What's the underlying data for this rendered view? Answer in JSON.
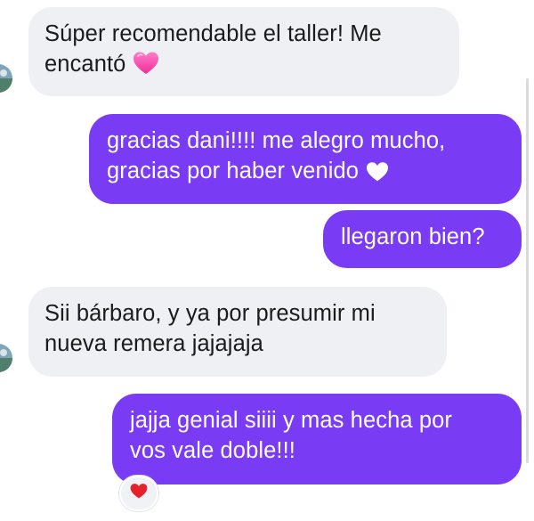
{
  "messages": [
    {
      "direction": "incoming",
      "lines": [
        "Súper recomendable el taller! Me",
        "encantó"
      ],
      "trailing_emoji": "pink-heart-icon"
    },
    {
      "direction": "outgoing",
      "lines": [
        "gracias dani!!!! me alegro mucho,",
        "gracias por haber venido"
      ],
      "trailing_emoji": "white-heart-icon"
    },
    {
      "direction": "outgoing",
      "lines": [
        "llegaron bien?"
      ]
    },
    {
      "direction": "incoming",
      "lines": [
        "Sii bárbaro, y ya por presumir mi",
        "nueva remera jajajaja"
      ]
    },
    {
      "direction": "outgoing",
      "lines": [
        "jajja genial siiii y mas hecha por",
        "vos vale doble!!!"
      ],
      "reaction": "red-heart-icon"
    }
  ],
  "colors": {
    "incoming_bubble": "#eff0f3",
    "outgoing_bubble": "#7a3bf5",
    "incoming_text": "#1b1b1b",
    "outgoing_text": "#ffffff"
  }
}
